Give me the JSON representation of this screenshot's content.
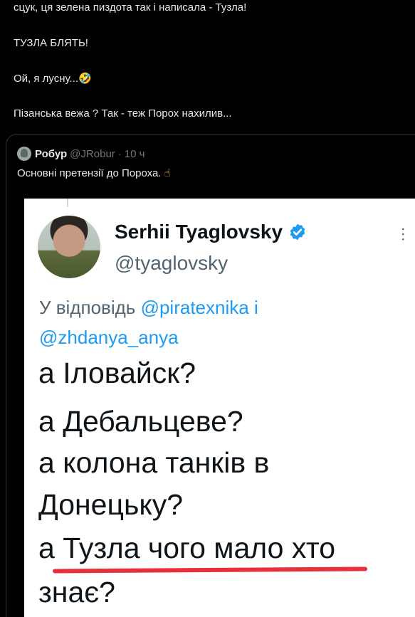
{
  "post": {
    "line1": "сцук, ця зелена пиздота так і написала - Тузла!",
    "line2": "ТУЗЛА БЛЯТЬ!",
    "line3": "Ой, я лусну...",
    "line3_emoji": "🤣",
    "line4": "Пізанська вежа ? Так - теж Порох нахилив..."
  },
  "quote": {
    "name": "Робур",
    "handle": "@JRobur",
    "separator": "·",
    "time": "10 ч",
    "text": "Основні претензії до Пороха.",
    "text_emoji": "☝"
  },
  "media": {
    "name": "Serhii Tyaglovsky",
    "handle": "@tyaglovsky",
    "more": "...",
    "reply_prefix": "У відповідь ",
    "reply_mention1": "@piratexnika",
    "reply_and": " і",
    "reply_mention2": "@zhdanya_anya",
    "lines": [
      "а Іловайск?",
      "а Дебальцеве?",
      "а колона танків в",
      "Донецьку?",
      "а Тузла чого мало хто",
      "знає?"
    ],
    "colors": {
      "underline": "#e8303d",
      "mention": "#1d9bf0",
      "verified": "#1d9bf0"
    }
  }
}
